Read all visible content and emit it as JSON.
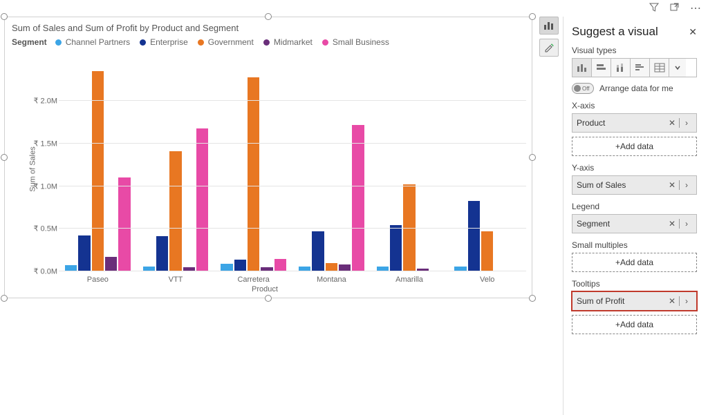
{
  "toolbar": {
    "filter_tip": "Filter",
    "popout_tip": "Focus mode",
    "more_tip": "More options"
  },
  "chart": {
    "title": "Sum of Sales and Sum of Profit by Product and Segment",
    "legend_label": "Segment",
    "y_axis_title": "Sum of Sales",
    "x_axis_title": "Product"
  },
  "mini_toolbar": {
    "build_tip": "Build visual",
    "format_tip": "Format visual"
  },
  "panel": {
    "title": "Suggest a visual",
    "visual_types_label": "Visual types",
    "toggle_off_text": "Off",
    "arrange_label": "Arrange data for me",
    "sections": {
      "x": "X-axis",
      "y": "Y-axis",
      "legend": "Legend",
      "small": "Small multiples",
      "tooltips": "Tooltips"
    },
    "fields": {
      "x": "Product",
      "y": "Sum of Sales",
      "legend": "Segment",
      "tooltips": "Sum of Profit"
    },
    "add_data_label": "+Add data"
  },
  "chart_data": {
    "type": "bar",
    "title": "Sum of Sales and Sum of Profit by Product and Segment",
    "xlabel": "Product",
    "ylabel": "Sum of Sales",
    "ylim": [
      0,
      2400000
    ],
    "y_ticks": [
      0,
      500000,
      1000000,
      1500000,
      2000000
    ],
    "y_tick_labels": [
      "₹ 0.0M",
      "₹ 0.5M",
      "₹ 1.0M",
      "₹ 1.5M",
      "₹ 2.0M"
    ],
    "categories": [
      "Paseo",
      "VTT",
      "Carretera",
      "Montana",
      "Amarilla",
      "Velo"
    ],
    "series": [
      {
        "name": "Channel Partners",
        "color": "#3ca5e6",
        "values": [
          70000,
          60000,
          90000,
          60000,
          60000,
          60000
        ]
      },
      {
        "name": "Enterprise",
        "color": "#143391",
        "values": [
          420000,
          410000,
          140000,
          470000,
          540000,
          830000
        ]
      },
      {
        "name": "Government",
        "color": "#e87722",
        "values": [
          2350000,
          1410000,
          2280000,
          100000,
          1020000,
          470000
        ]
      },
      {
        "name": "Midmarket",
        "color": "#6a2e7a",
        "values": [
          170000,
          50000,
          50000,
          80000,
          30000,
          0
        ]
      },
      {
        "name": "Small Business",
        "color": "#e84aa6",
        "values": [
          1100000,
          1680000,
          150000,
          1720000,
          0,
          0
        ]
      }
    ]
  }
}
